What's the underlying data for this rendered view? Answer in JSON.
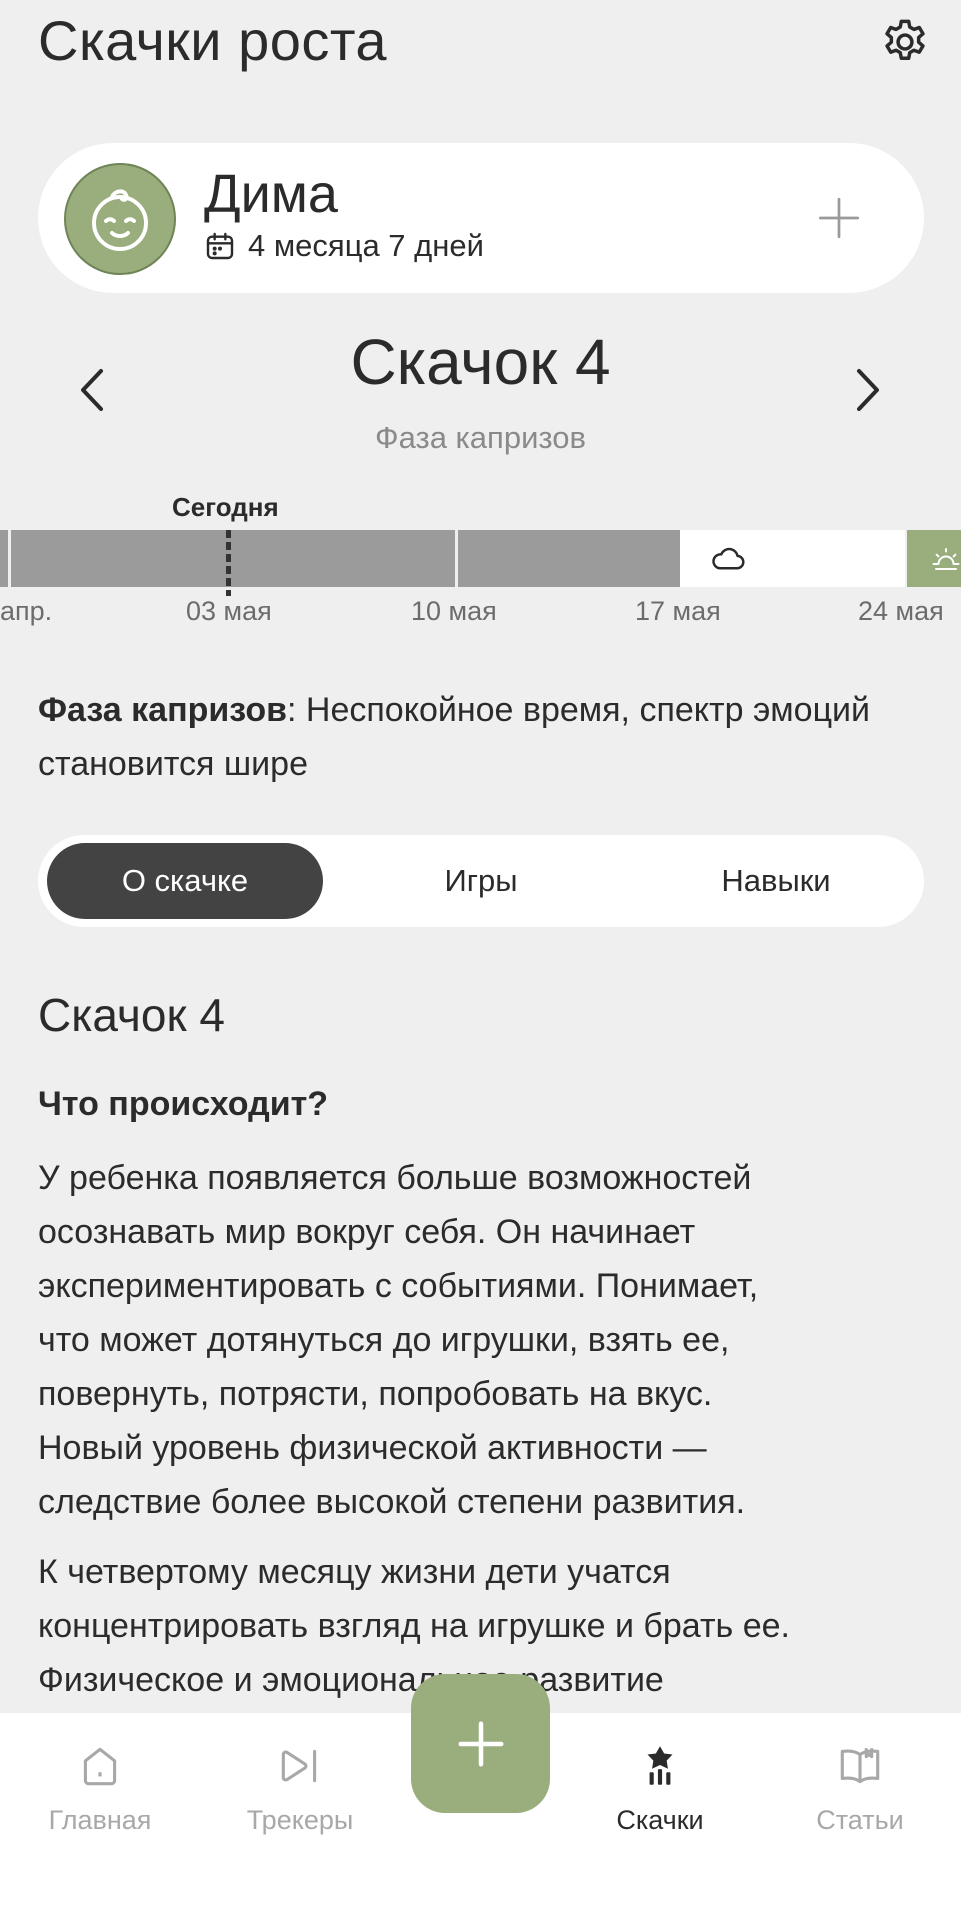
{
  "header": {
    "title": "Скачки роста",
    "settings_icon": "gear-icon"
  },
  "profile": {
    "name": "Дима",
    "age": "4 месяца 7 дней",
    "avatar_icon": "baby-face-icon",
    "add_icon": "plus-icon"
  },
  "leap": {
    "title": "Скачок 4",
    "phase": "Фаза капризов"
  },
  "timeline": {
    "today_label": "Сегодня",
    "ticks": [
      "апр.",
      "03 мая",
      "10 мая",
      "17 мая",
      "24 мая"
    ],
    "stormy_icon": "cloud-icon",
    "sunny_icon": "sun-icon"
  },
  "phase_description": {
    "term": "Фаза капризов",
    "text": ": Неспокойное время, спектр эмоций становится шире"
  },
  "tabs": [
    {
      "label": "О скачке",
      "active": true
    },
    {
      "label": "Игры",
      "active": false
    },
    {
      "label": "Навыки",
      "active": false
    }
  ],
  "content": {
    "title": "Скачок 4",
    "question": "Что происходит?",
    "p1_lines": [
      "У ребенка появляется больше возможностей",
      "осознавать мир вокруг себя. Он начинает",
      "экспериментировать с событиями. Понимает,",
      "что может дотянуться до игрушки, взять ее,",
      "повернуть, потрясти, попробовать на вкус.",
      "Новый уровень физической активности —",
      "следствие более высокой степени развития."
    ],
    "p2_lines": [
      "К четвертому месяцу жизни дети учатся",
      "концентрировать взгляд на игрушке и брать ее.",
      "Физическое и эмоциональное развитие"
    ]
  },
  "bottom_nav": [
    {
      "label": "Главная",
      "icon": "home-icon",
      "active": false
    },
    {
      "label": "Трекеры",
      "icon": "play-skip-icon",
      "active": false
    },
    {
      "label": "Скачки",
      "icon": "leap-chart-icon",
      "active": true
    },
    {
      "label": "Статьи",
      "icon": "book-icon",
      "active": false
    }
  ],
  "fab": {
    "icon": "plus-icon"
  },
  "colors": {
    "accent": "#9aad7d",
    "active_tab": "#434343",
    "background": "#efefef"
  }
}
